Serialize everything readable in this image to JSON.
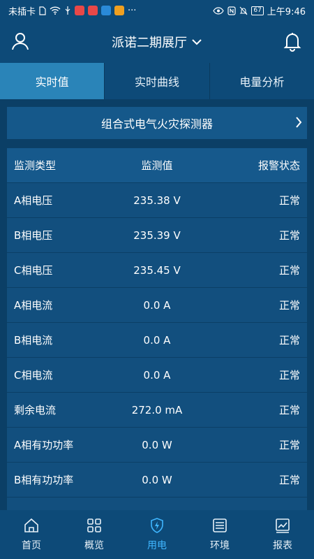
{
  "status_bar": {
    "carrier": "未插卡",
    "battery": "67",
    "time": "上午9:46"
  },
  "header": {
    "title": "派诺二期展厅"
  },
  "tabs": [
    {
      "label": "实时值",
      "active": true
    },
    {
      "label": "实时曲线",
      "active": false
    },
    {
      "label": "电量分析",
      "active": false
    }
  ],
  "device": {
    "name": "组合式电气火灾探测器"
  },
  "table": {
    "headers": [
      "监测类型",
      "监测值",
      "报警状态"
    ],
    "rows": [
      {
        "type": "A相电压",
        "value": "235.38 V",
        "status": "正常"
      },
      {
        "type": "B相电压",
        "value": "235.39 V",
        "status": "正常"
      },
      {
        "type": "C相电压",
        "value": "235.45 V",
        "status": "正常"
      },
      {
        "type": "A相电流",
        "value": "0.0 A",
        "status": "正常"
      },
      {
        "type": "B相电流",
        "value": "0.0 A",
        "status": "正常"
      },
      {
        "type": "C相电流",
        "value": "0.0 A",
        "status": "正常"
      },
      {
        "type": "剩余电流",
        "value": "272.0 mA",
        "status": "正常"
      },
      {
        "type": "A相有功功率",
        "value": "0.0 W",
        "status": "正常"
      },
      {
        "type": "B相有功功率",
        "value": "0.0 W",
        "status": "正常"
      }
    ]
  },
  "bottom_nav": [
    {
      "label": "首页",
      "icon": "home-icon",
      "active": false
    },
    {
      "label": "概览",
      "icon": "grid-icon",
      "active": false
    },
    {
      "label": "用电",
      "icon": "power-shield-icon",
      "active": true
    },
    {
      "label": "环境",
      "icon": "monitor-icon",
      "active": false
    },
    {
      "label": "报表",
      "icon": "chart-icon",
      "active": false
    }
  ],
  "colors": {
    "background": "#0b3f66",
    "bar": "#0d4a78",
    "tab_active": "#2a84b8",
    "nav_active": "#3fb6ff"
  }
}
